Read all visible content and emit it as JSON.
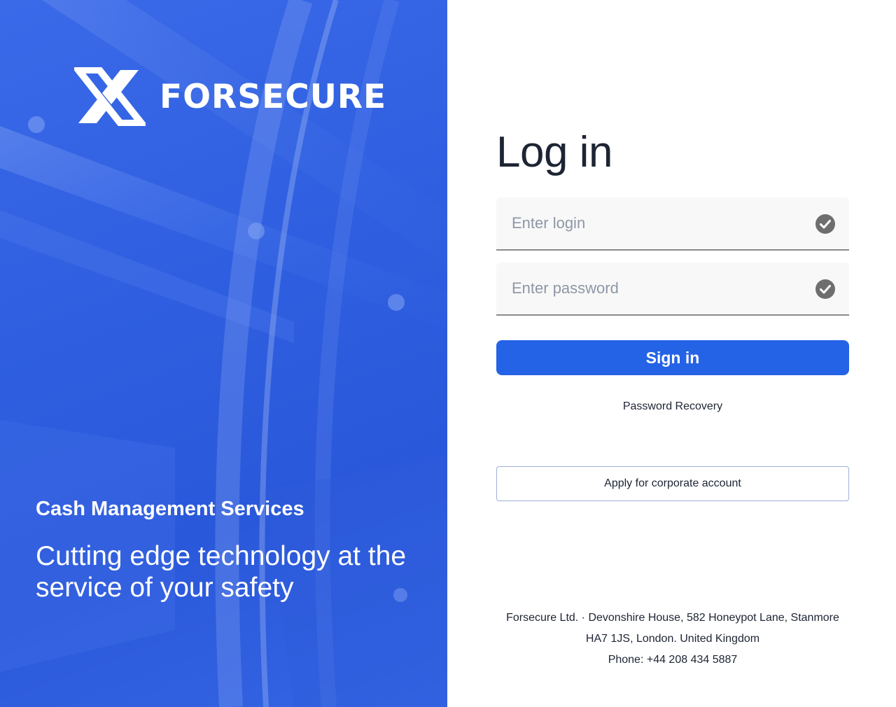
{
  "brand": {
    "name": "FORSECURE",
    "logo_icon": "x-logo-icon"
  },
  "hero": {
    "subtitle": "Cash Management Services",
    "tagline_line1": "Cutting edge technology at the",
    "tagline_line2": "service of your safety"
  },
  "login": {
    "title": "Log in",
    "login_field": {
      "placeholder": "Enter login",
      "value": "",
      "icon": "check-circle-icon"
    },
    "password_field": {
      "placeholder": "Enter password",
      "value": "",
      "icon": "check-circle-icon"
    },
    "sign_in_label": "Sign in",
    "recovery_label": "Password Recovery",
    "apply_label": "Apply for corporate account"
  },
  "footer": {
    "line1": "Forsecure Ltd. · Devonshire House, 582 Honeypot Lane, Stanmore",
    "line2": "HA7 1JS, London. United Kingdom",
    "line3": "Phone: +44 208 434 5887"
  },
  "colors": {
    "hero_blue": "#2f5fe0",
    "accent": "#2563e6",
    "text_dark": "#1d2433",
    "placeholder": "#8e97a6",
    "icon_grey": "#6e6e6e"
  }
}
